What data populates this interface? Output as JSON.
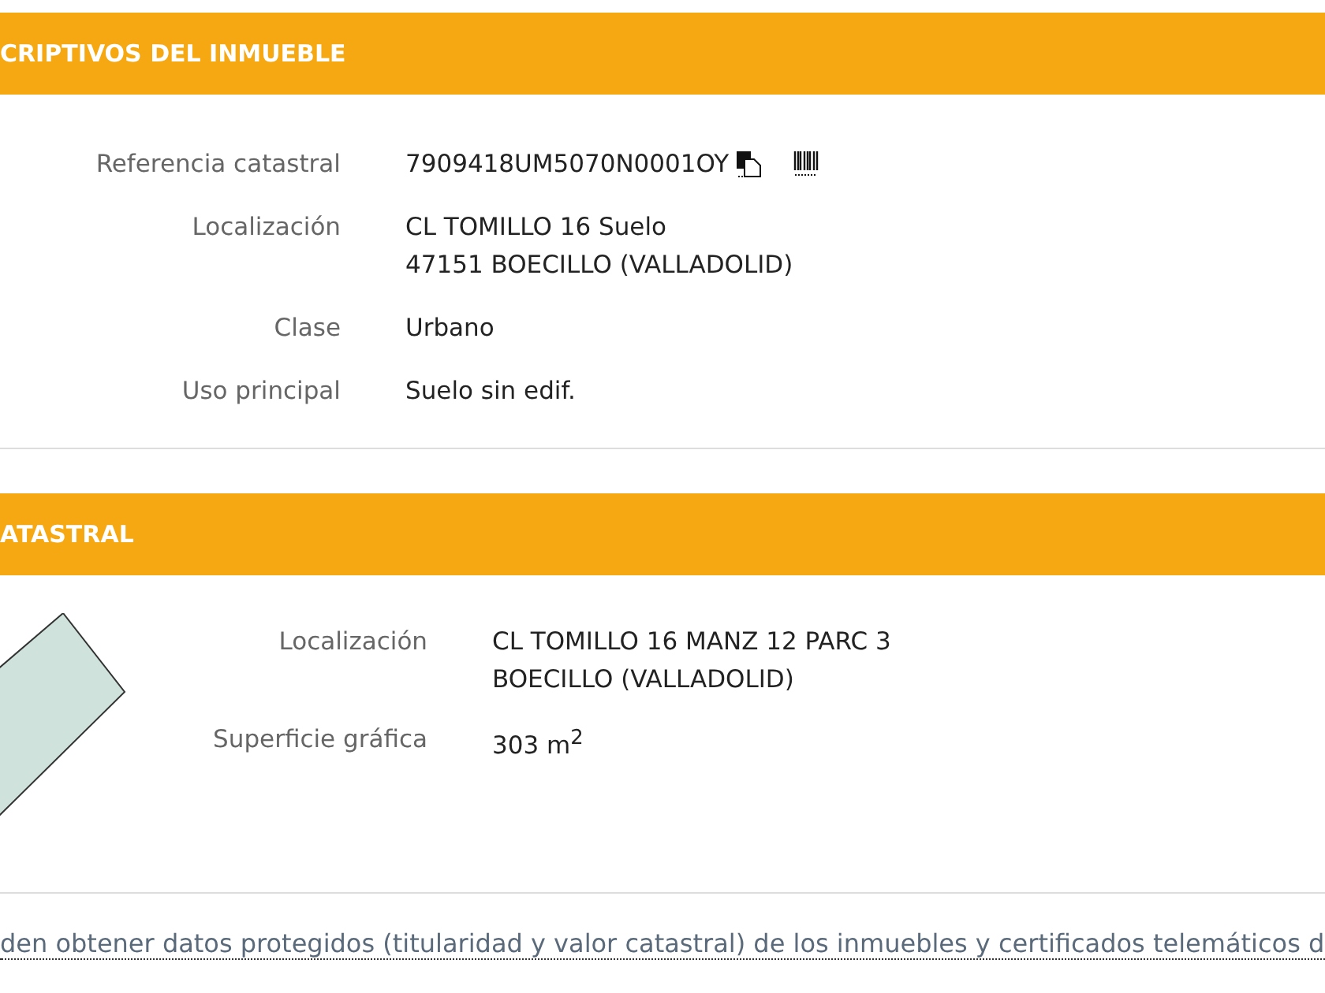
{
  "sections": [
    {
      "title": "CRIPTIVOS DEL INMUEBLE",
      "kind": "fields",
      "fields": [
        {
          "label": "Referencia catastral",
          "lines": [
            "7909418UM5070N0001OY"
          ],
          "tools": true
        },
        {
          "label": "Localización",
          "lines": [
            "CL TOMILLO 16 Suelo",
            "47151 BOECILLO (VALLADOLID)"
          ]
        },
        {
          "label": "Clase",
          "lines": [
            "Urbano"
          ]
        },
        {
          "label": "Uso principal",
          "lines": [
            "Suelo sin edif."
          ]
        }
      ]
    },
    {
      "title": "ATASTRAL",
      "kind": "parcel",
      "fields": [
        {
          "label": "Localización",
          "lines": [
            "CL TOMILLO 16 MANZ 12 PARC 3",
            "BOECILLO (VALLADOLID)"
          ]
        },
        {
          "label": "Superficie gráfica",
          "lines": [
            "303 m$^{2}$"
          ]
        }
      ]
    }
  ],
  "footer_link": "den obtener datos protegidos (titularidad y valor catastral) de los inmuebles y certificados telemáticos d"
}
